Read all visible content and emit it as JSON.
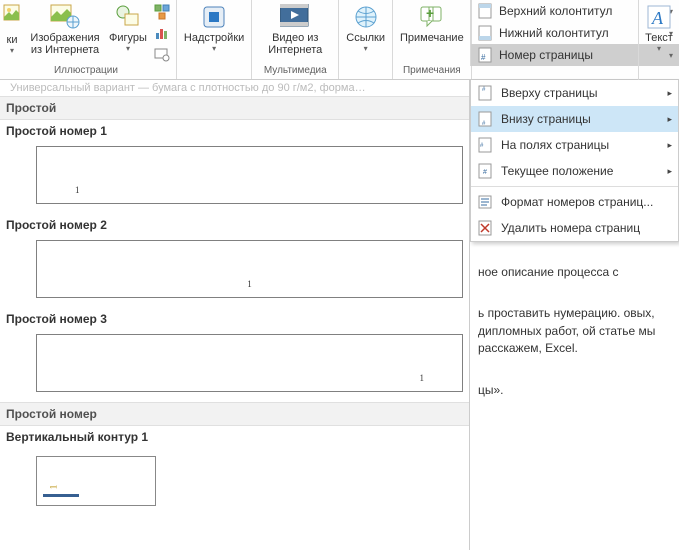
{
  "ribbon": {
    "pictures": {
      "label": "ки",
      "arrow": "▾"
    },
    "onlinePictures": {
      "label": "Изображения из Интернета"
    },
    "shapes": {
      "label": "Фигуры",
      "arrow": "▾"
    },
    "illustrationsCaption": "Иллюстрации",
    "addins": {
      "label": "Надстройки",
      "arrow": "▾"
    },
    "onlineVideo": {
      "label": "Видео из Интернета"
    },
    "multimediaCaption": "Мультимедиа",
    "links": {
      "label": "Ссылки",
      "arrow": "▾"
    },
    "comment": {
      "label": "Примечание"
    },
    "commentsCaption": "Примечания",
    "header": {
      "label": "Верхний колонтитул",
      "arrow": "▾"
    },
    "footer": {
      "label": "Нижний колонтитул",
      "arrow": "▾"
    },
    "pageNumber": {
      "label": "Номер страницы",
      "arrow": "▾"
    },
    "text": {
      "label": "Текст",
      "arrow": "▾"
    }
  },
  "pnmenu": {
    "top": {
      "label": "Вверху страницы",
      "arrow": "▸"
    },
    "bottom": {
      "label": "Внизу страницы",
      "arrow": "▸"
    },
    "margins": {
      "label": "На полях страницы",
      "arrow": "▸"
    },
    "current": {
      "label": "Текущее положение",
      "arrow": "▸"
    },
    "format": {
      "label": "Формат номеров страниц..."
    },
    "remove": {
      "label": "Удалить номера страниц"
    }
  },
  "gallery": {
    "cat1": "Простой",
    "opt1": "Простой номер 1",
    "opt2": "Простой номер 2",
    "opt3": "Простой номер 3",
    "cat2": "Простой номер",
    "vc1": "Вертикальный контур 1",
    "sample": "1"
  },
  "doc": {
    "truncated": "Универсальный вариант — бумага с плотностью до 90 г/м2, форма…",
    "p1": "ное описание процесса с",
    "p2": "ь проставить нумерацию. овых, дипломных работ, ой статье мы расскажем, Excel.",
    "p3": "цы»."
  }
}
